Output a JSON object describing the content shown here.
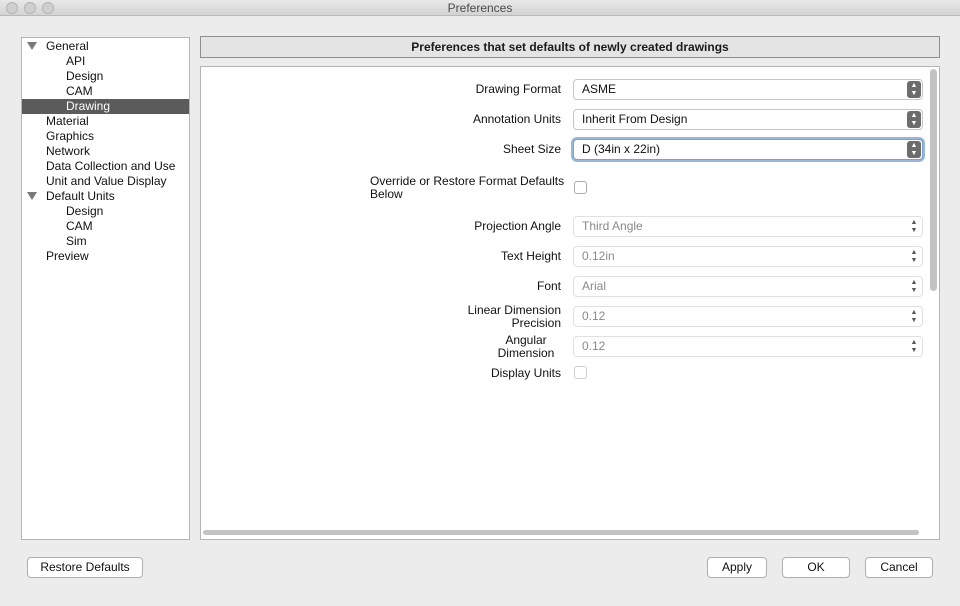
{
  "window": {
    "title": "Preferences"
  },
  "tree": {
    "items": [
      {
        "label": "General",
        "expanded": true
      },
      {
        "label": "API"
      },
      {
        "label": "Design"
      },
      {
        "label": "CAM"
      },
      {
        "label": "Drawing",
        "selected": true
      },
      {
        "label": "Material"
      },
      {
        "label": "Graphics"
      },
      {
        "label": "Network"
      },
      {
        "label": "Data Collection and Use"
      },
      {
        "label": "Unit and Value Display"
      },
      {
        "label": "Default Units",
        "expanded": true
      },
      {
        "label": "Design"
      },
      {
        "label": "CAM"
      },
      {
        "label": "Sim"
      },
      {
        "label": "Preview"
      }
    ]
  },
  "header": {
    "title": "Preferences that set defaults of newly created drawings"
  },
  "form": {
    "drawing_format": {
      "label": "Drawing Format",
      "value": "ASME"
    },
    "annotation_units": {
      "label": "Annotation Units",
      "value": "Inherit From Design"
    },
    "sheet_size": {
      "label": "Sheet Size",
      "value": "D (34in x 22in)"
    },
    "override": {
      "label_line1": "Override or Restore Format Defaults",
      "label_line2": "Below",
      "checked": false
    },
    "projection_angle": {
      "label": "Projection Angle",
      "value": "Third Angle"
    },
    "text_height": {
      "label": "Text Height",
      "value": "0.12in"
    },
    "font": {
      "label": "Font",
      "value": "Arial"
    },
    "linear_precision": {
      "label_line1": "Linear Dimension",
      "label_line2": "Precision",
      "value": "0.12"
    },
    "angular_precision": {
      "label_line1": "Angular",
      "label_line2": "Dimension",
      "value": "0.12"
    },
    "display_units": {
      "label": "Display Units",
      "checked": false
    }
  },
  "buttons": {
    "restore_defaults": "Restore Defaults",
    "apply": "Apply",
    "ok": "OK",
    "cancel": "Cancel"
  },
  "icons": {
    "traffic_lights": "window-control-icons",
    "tree_expand": "disclosure-triangle-icon",
    "select_stepper": "up-down-chevron-icon"
  }
}
